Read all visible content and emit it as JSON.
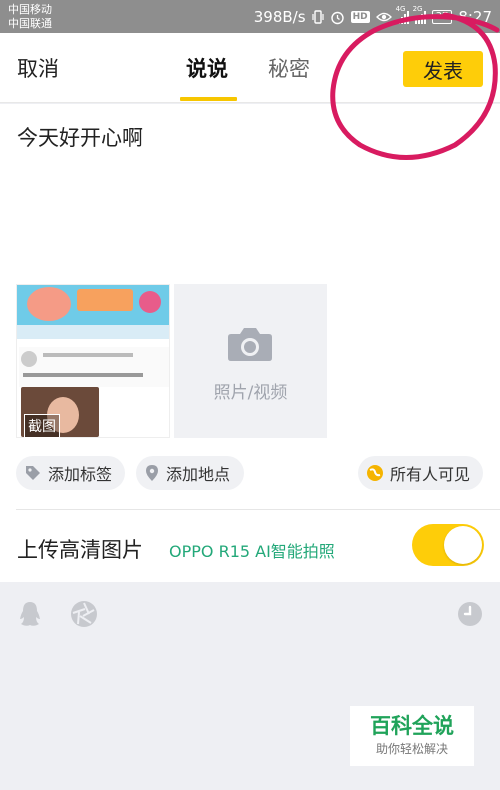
{
  "status_bar": {
    "carrier_1": "中国移动",
    "carrier_2": "中国联通",
    "net_speed": "398B/s",
    "hd_badge": "HD",
    "signal_1_tag": "4G",
    "signal_2_tag": "2G",
    "battery": "37",
    "time": "8:27",
    "icons": [
      "vibrate-icon",
      "alarm-icon",
      "hd-icon",
      "eye-icon",
      "signal-icon",
      "battery-icon"
    ]
  },
  "header": {
    "cancel_label": "取消",
    "tabs": [
      {
        "label": "说说",
        "active": true
      },
      {
        "label": "秘密",
        "active": false
      }
    ],
    "publish_label": "发表"
  },
  "post": {
    "text": "今天好开心啊"
  },
  "media": {
    "thumbnail_badge": "截图",
    "add_photo_label": "照片/视频",
    "add_photo_icon": "camera-icon"
  },
  "chips": {
    "tag_label": "添加标签",
    "location_label": "添加地点",
    "visibility_label": "所有人可见"
  },
  "upload": {
    "label": "上传高清图片",
    "promo": "OPPO R15  AI智能拍照",
    "toggle_on": true
  },
  "toolbar": {
    "icons": [
      "qq-icon",
      "shutter-icon",
      "clock-icon"
    ]
  },
  "watermark": {
    "title": "百科全说",
    "subtitle": "助你轻松解决"
  },
  "colors": {
    "accent": "#fecd09",
    "promo": "#23a879",
    "annotation": "#d81b60",
    "statusbar": "#8e8e8e"
  }
}
